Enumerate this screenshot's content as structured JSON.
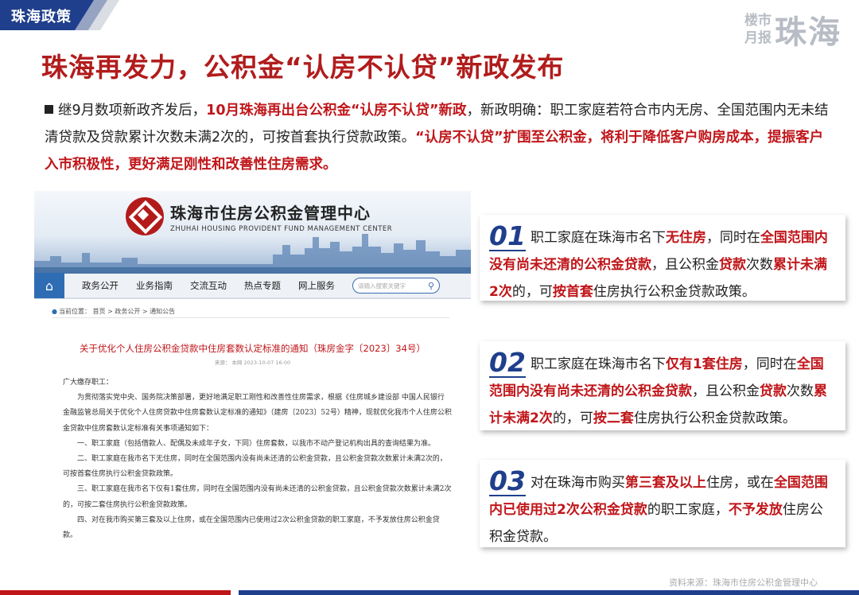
{
  "header": {
    "section_tag": "珠海政策",
    "brand_small_1": "楼市",
    "brand_small_2": "月报",
    "brand_big": "珠海"
  },
  "title": "珠海再发力，公积金“认房不认贷”新政发布",
  "intro": {
    "part1": "继9月数项新政齐发后，",
    "part2_red": "10月珠海再出台公积金“认房不认贷”新政",
    "part3": "，新政明确：职工家庭若符合市内无房、全国范围内无未结清贷款及贷款累计次数未满2次的，可按首套执行贷款政策。",
    "part4_red": "“认房不认贷”扩围至公积金，将利于降低客户购房成本，提振客户入市积极性，更好满足刚性和改善性住房需求。"
  },
  "doc": {
    "org_cn": "珠海市住房公积金管理中心",
    "org_en": "ZHUHAI HOUSING PROVIDENT FUND MANAGEMENT CENTER",
    "nav": [
      "政务公开",
      "业务指南",
      "交流互动",
      "热点专题",
      "网上服务"
    ],
    "search_placeholder": "请输入搜索关键字",
    "breadcrumb": "当前位置： 首页 > 政务公开 > 通知公告",
    "notice_title": "关于优化个人住房公积金贷款中住房套数认定标准的通知（珠房金字〔2023〕34号）",
    "notice_meta": "来源： 本网 2023-10-07 16:00",
    "body": [
      "广大缴存职工：",
      "为贯彻落实党中央、国务院决策部署，更好地满足职工刚性和改善性住房需求，根据《住房城乡建设部 中国人民银行 金融监管总局关于优化个人住房贷款中住房套数认定标准的通知》（建房〔2023〕52号）精神，现就优化我市个人住房公积金贷款中住房套数认定标准有关事项通知如下：",
      "一、职工家庭（包括借款人、配偶及未成年子女，下同）住房套数，以我市不动产登记机构出具的查询结果为准。",
      "二、职工家庭在我市名下无住房，同时在全国范围内没有尚未还清的公积金贷款，且公积金贷款次数累计未满2次的，可按首套住房执行公积金贷款政策。",
      "三、职工家庭在我市名下仅有1套住房，同时在全国范围内没有尚未还清的公积金贷款，且公积金贷款次数累计未满2次的，可按二套住房执行公积金贷款政策。",
      "四、对在我市购买第三套及以上住房，或在全国范围内已使用过2次公积金贷款的职工家庭，不予发放住房公积金贷款。"
    ]
  },
  "cards": [
    {
      "num": "01",
      "segments": [
        {
          "t": "职工家庭在珠海市名下",
          "r": false
        },
        {
          "t": "无住房",
          "r": true
        },
        {
          "t": "，同时在",
          "r": false
        },
        {
          "t": "全国范围内没有尚未还清的公积金贷款",
          "r": true
        },
        {
          "t": "，且公积金",
          "r": false
        },
        {
          "t": "贷款",
          "r": true
        },
        {
          "t": "次数",
          "r": false
        },
        {
          "t": "累计未满2次",
          "r": true
        },
        {
          "t": "的，可",
          "r": false
        },
        {
          "t": "按首套",
          "r": true
        },
        {
          "t": "住房执行公积金贷款政策。",
          "r": false
        }
      ]
    },
    {
      "num": "02",
      "segments": [
        {
          "t": "职工家庭在珠海市名下",
          "r": false
        },
        {
          "t": "仅有1套住房",
          "r": true
        },
        {
          "t": "，同时在",
          "r": false
        },
        {
          "t": "全国范围内没有尚未还清的公积金贷款",
          "r": true
        },
        {
          "t": "，且公积金",
          "r": false
        },
        {
          "t": "贷款",
          "r": true
        },
        {
          "t": "次数",
          "r": false
        },
        {
          "t": "累计未满2次",
          "r": true
        },
        {
          "t": "的，可",
          "r": false
        },
        {
          "t": "按二套",
          "r": true
        },
        {
          "t": "住房执行公积金贷款政策。",
          "r": false
        }
      ]
    },
    {
      "num": "03",
      "segments": [
        {
          "t": "对在珠海市购买",
          "r": false
        },
        {
          "t": "第三套及以上",
          "r": true
        },
        {
          "t": "住房，或在",
          "r": false
        },
        {
          "t": "全国范围内已使用过2次公积金贷款",
          "r": true
        },
        {
          "t": "的职工家庭，",
          "r": false
        },
        {
          "t": "不予发放",
          "r": true
        },
        {
          "t": "住房公积金贷款。",
          "r": false
        }
      ]
    }
  ],
  "source": "资料来源：珠海市住房公积金管理中心",
  "colors": {
    "brand_blue": "#1f3f8c",
    "accent_red": "#c0161a"
  }
}
